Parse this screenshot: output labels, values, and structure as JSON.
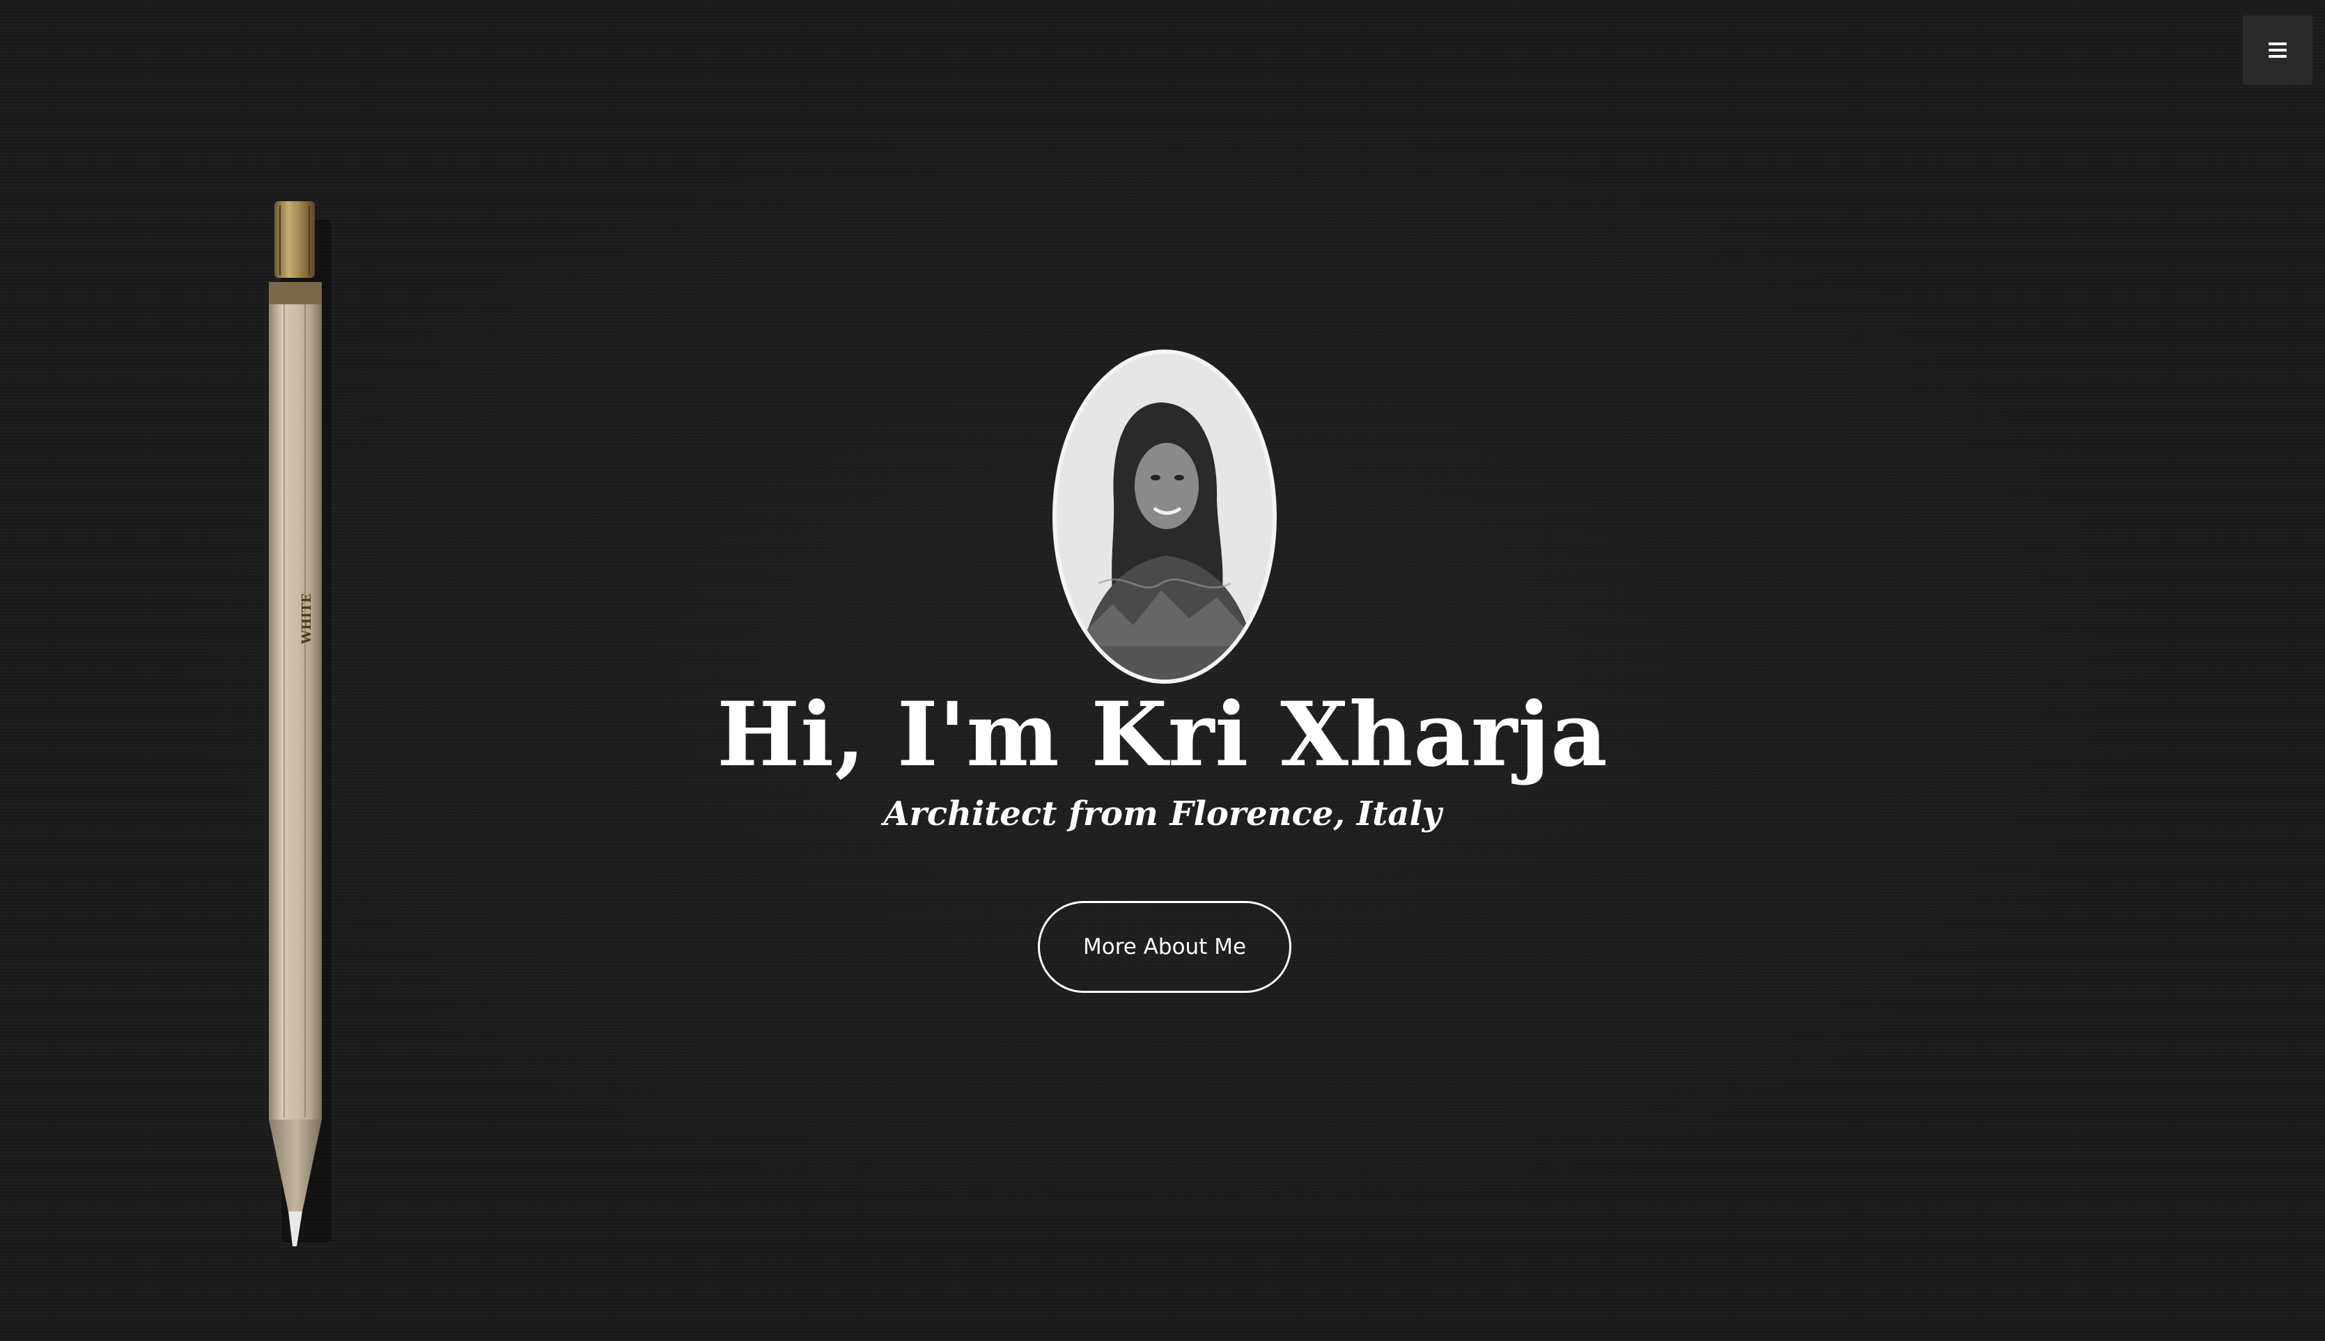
{
  "header": {
    "menu_icon": "hamburger-menu-icon"
  },
  "hero": {
    "avatar_alt": "portrait-photo",
    "title": "Hi, I'm Kri Xharja",
    "subtitle": "Architect from Florence, Italy",
    "cta_label": "More About Me"
  },
  "decoration": {
    "pencil_label": "WHITE"
  },
  "colors": {
    "background": "#1b1b1b",
    "text": "#ffffff",
    "menu_bg": "#2a2a2a",
    "accent_gold": "#a08a5a"
  }
}
